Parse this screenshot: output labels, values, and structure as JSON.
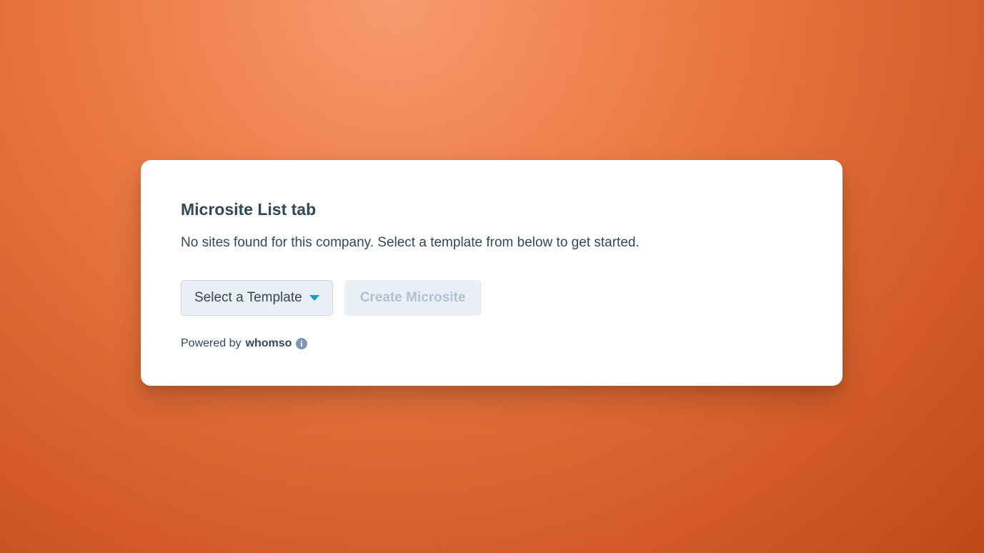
{
  "card": {
    "heading": "Microsite List tab",
    "description": "No sites found for this company. Select a template from below to get started.",
    "select_label": "Select a Template",
    "create_label": "Create Microsite",
    "footer_prefix": "Powered by ",
    "footer_brand": "whomso"
  }
}
